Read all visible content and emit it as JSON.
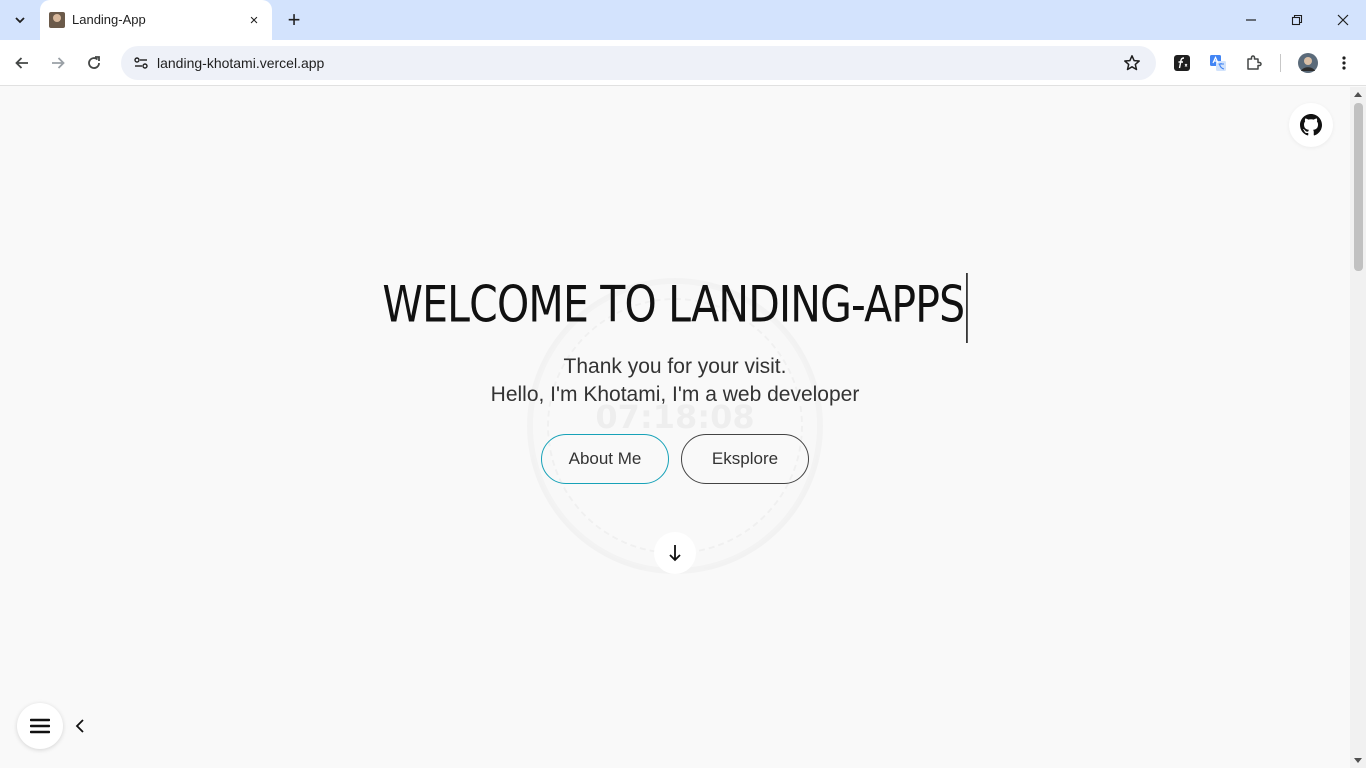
{
  "browser": {
    "tab": {
      "title": "Landing-App",
      "close_label": "×"
    },
    "new_tab_label": "+",
    "url": "landing-khotami.vercel.app"
  },
  "page": {
    "heading": "WELCOME TO LANDING-APPS",
    "subtitle_line1": "Thank you for your visit.",
    "subtitle_line2": "Hello, I'm Khotami, I'm a web developer",
    "clock_time": "07:18:08",
    "buttons": {
      "about": "About Me",
      "explore": "Eksplore"
    }
  },
  "colors": {
    "accent": "#17a2b8",
    "tabstrip": "#d3e3fd",
    "page_bg": "#f9f9f9"
  },
  "icons": [
    "tab-search-icon",
    "back-icon",
    "forward-icon",
    "reload-icon",
    "site-info-icon",
    "star-icon",
    "font-extension-icon",
    "translate-icon",
    "extensions-icon",
    "profile-avatar",
    "more-icon",
    "github-icon",
    "arrow-down-icon",
    "hamburger-icon",
    "chevron-left-icon"
  ]
}
